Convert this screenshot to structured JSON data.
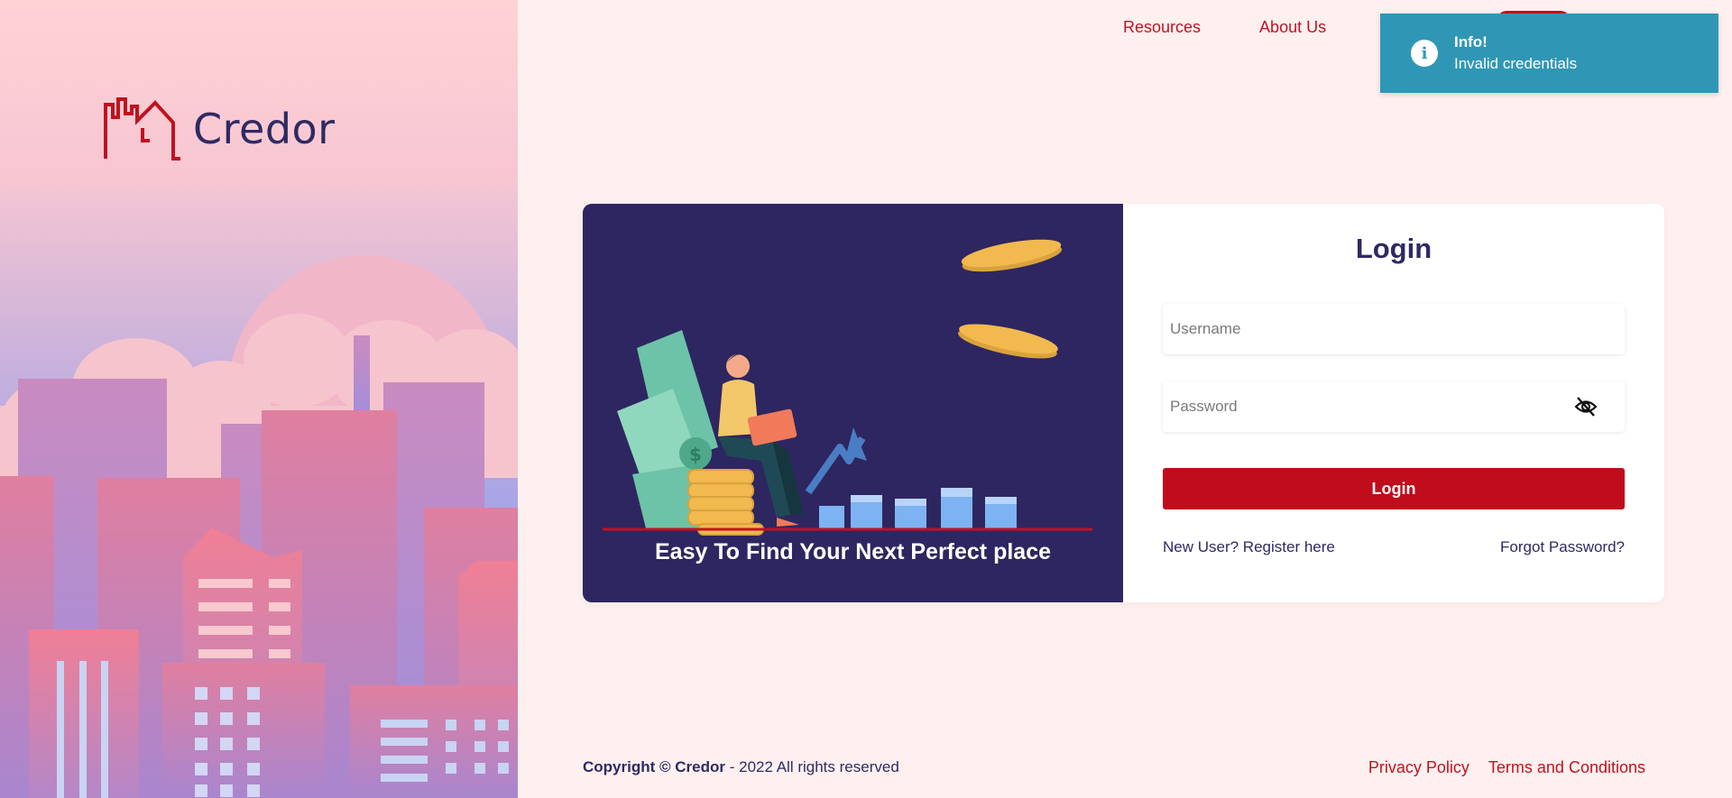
{
  "brand": {
    "name": "Credor"
  },
  "nav": {
    "items": [
      "Resources",
      "About Us"
    ]
  },
  "toast": {
    "title": "Info!",
    "message": "Invalid credentials",
    "icon": "info-icon"
  },
  "hero": {
    "tagline": "Easy To Find Your Next Perfect place"
  },
  "login": {
    "title": "Login",
    "username_placeholder": "Username",
    "password_placeholder": "Password",
    "submit_label": "Login",
    "register_link": "New User? Register here",
    "forgot_link": "Forgot Password?"
  },
  "footer": {
    "copyright_prefix": "Copyright ©",
    "copyright_brand": "Credor",
    "copyright_suffix": "- 2022 All rights reserved",
    "links": [
      "Privacy Policy",
      "Terms and Conditions"
    ]
  },
  "colors": {
    "primary": "#c00c1b",
    "navy": "#2e2a63",
    "toast": "#2f97b5",
    "background": "#fff0f0"
  }
}
